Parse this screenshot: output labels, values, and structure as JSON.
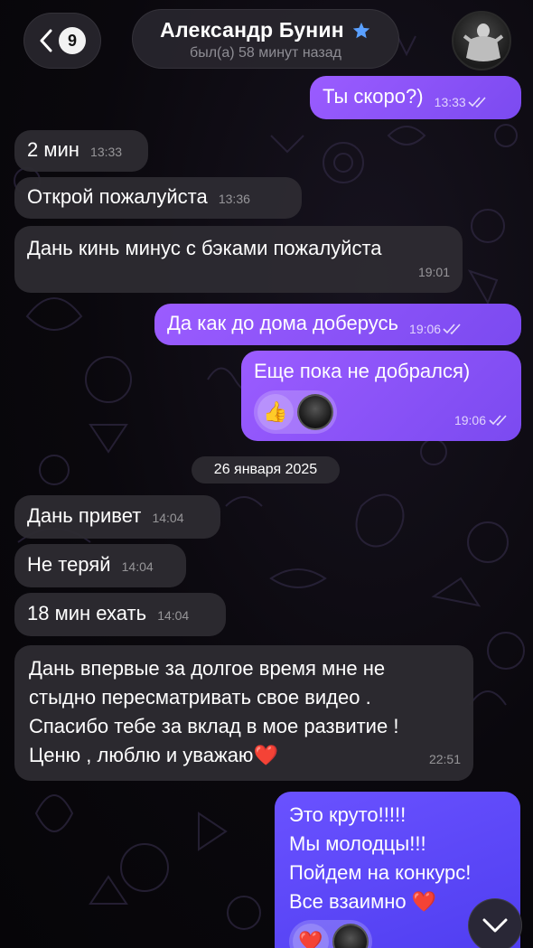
{
  "header": {
    "unread_count": "9",
    "contact_name": "Александр Бунин",
    "status": "был(а) 58 минут назад"
  },
  "messages": [
    {
      "dir": "out",
      "text": "Ты скоро?)",
      "time": "13:33",
      "read": true
    },
    {
      "dir": "in",
      "text": "2 мин",
      "time": "13:33"
    },
    {
      "dir": "in",
      "text": "Открой пожалуйста",
      "time": "13:36"
    },
    {
      "dir": "in",
      "text": "Дань кинь минус с бэками пожалуйста",
      "time": "19:01"
    },
    {
      "dir": "out",
      "text": "Да как до дома доберусь",
      "time": "19:06",
      "read": true
    },
    {
      "dir": "out",
      "text": "Еще пока не добрался)",
      "time": "19:06",
      "read": true,
      "reactions": [
        "👍",
        "avatar"
      ]
    },
    {
      "dir": "in",
      "text": "Дань привет",
      "time": "14:04"
    },
    {
      "dir": "in",
      "text": "Не теряй",
      "time": "14:04"
    },
    {
      "dir": "in",
      "text": "18 мин ехать",
      "time": "14:04"
    },
    {
      "dir": "in",
      "lines": [
        "Дань впервые за долгое время мне не",
        "стыдно пересматривать свое видео .",
        "Спасибо тебе за вклад в мое развитие !",
        "Ценю , люблю и уважаю"
      ],
      "emoji": "❤️",
      "time": "22:51"
    },
    {
      "dir": "out",
      "lines": [
        "Это круто!!!!!",
        "Мы молодцы!!!",
        "Пойдем на конкурс!",
        "Все взаимно"
      ],
      "emoji": "❤️",
      "reactions": [
        "❤️",
        "avatar"
      ]
    }
  ],
  "date_separator": "26 января 2025",
  "colors": {
    "outgoing": "#8f55fb",
    "incoming": "#2d2b32",
    "accent_star": "#5aa0ff"
  },
  "icons": [
    "back-chevron-icon",
    "verified-star-icon",
    "double-check-icon",
    "scroll-down-chevron-icon"
  ]
}
